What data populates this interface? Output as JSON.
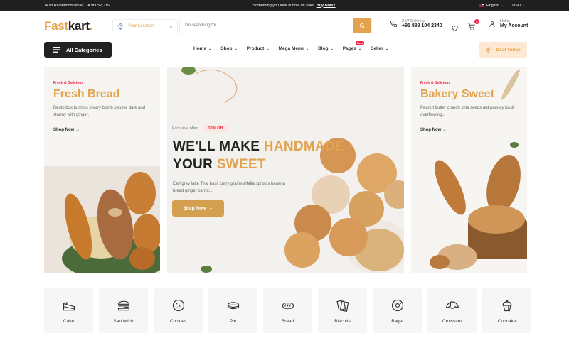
{
  "topbar": {
    "address": "1418 Riverwood Drive, CA 96052, US",
    "promo": "Something you love is now on sale!",
    "promo_link": "Buy Now !",
    "language": "English",
    "currency": "USD"
  },
  "header": {
    "logo_part1": "Fast",
    "logo_part2": "kart",
    "logo_dot": ".",
    "location_label": "Your Location",
    "search_placeholder": "I'm searching for...",
    "delivery_label": "24/7 Delivery",
    "delivery_phone": "+91 888 104 2340",
    "cart_count": "0",
    "account_greeting": "Hello,",
    "account_label": "My Account"
  },
  "nav": {
    "categories_button": "All Categories",
    "menu": [
      {
        "label": "Home"
      },
      {
        "label": "Shop"
      },
      {
        "label": "Product"
      },
      {
        "label": "Mega Menu"
      },
      {
        "label": "Blog"
      },
      {
        "label": "Pages",
        "badge": "New"
      },
      {
        "label": "Seller"
      }
    ],
    "deal_button": "Deal Today"
  },
  "banners": {
    "left": {
      "tag": "Fresh & Delicious",
      "title": "Fresh Bread",
      "desc": "Bento box burritos cherry bomb pepper dark and stormy with ginger.",
      "link": "Shop Now"
    },
    "center": {
      "offer_label": "Exclusive offer",
      "offer_pct": "30% Off",
      "title_line1_a": "WE'LL MAKE ",
      "title_line1_b": "HANDMADE",
      "title_line2_a": "YOUR ",
      "title_line2_b": "SWEET",
      "desc": "Earl grey latte Thai basil curry grains alfalfa sprouts banana bread ginger carrot...",
      "button": "Shop Now"
    },
    "right": {
      "tag": "Fresh & Delicious",
      "title": "Bakery Sweet",
      "desc": "Peanut butter crunch chia seeds red parsley basil overflowing..",
      "link": "Shop Now"
    }
  },
  "categories": [
    {
      "label": "Cake",
      "icon": "cake-icon"
    },
    {
      "label": "Sandwich",
      "icon": "sandwich-icon"
    },
    {
      "label": "Cookies",
      "icon": "cookie-icon"
    },
    {
      "label": "Pie",
      "icon": "pie-icon"
    },
    {
      "label": "Bread",
      "icon": "bread-icon"
    },
    {
      "label": "Biscuits",
      "icon": "biscuits-icon"
    },
    {
      "label": "Bagel",
      "icon": "bagel-icon"
    },
    {
      "label": "Croissant",
      "icon": "croissant-icon"
    },
    {
      "label": "Cupcake",
      "icon": "cupcake-icon"
    }
  ],
  "colors": {
    "accent": "#e3a24c",
    "dark": "#222222",
    "sale": "#ee2244"
  }
}
